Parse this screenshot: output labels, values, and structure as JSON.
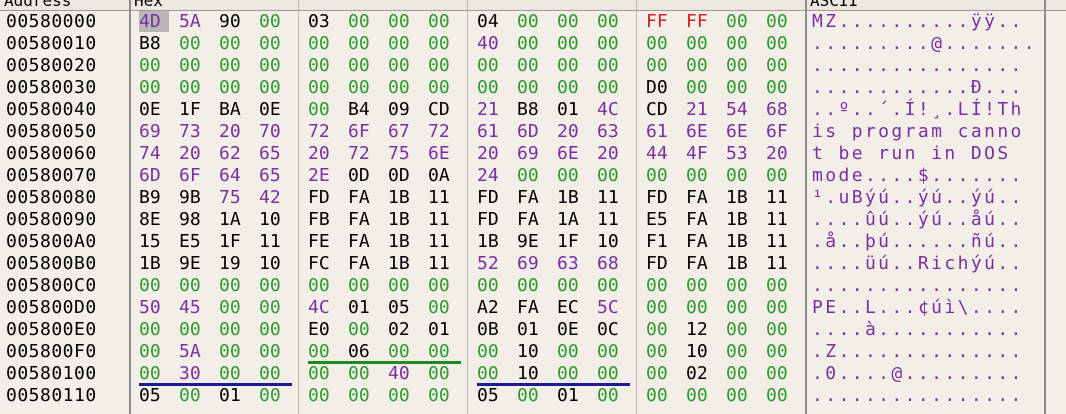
{
  "headers": {
    "address": "Address",
    "hex": "Hex",
    "ascii": "ASCII"
  },
  "colors": {
    "zero": "#2e9a2e",
    "low": "#000000",
    "ascii_byte": "#7a2fa0",
    "ff": "#d42020",
    "underline_blue": "#1a1a9a",
    "underline_green": "#1f8a1f"
  },
  "rows": [
    {
      "address": "00580000",
      "bytes": [
        "4D",
        "5A",
        "90",
        "00",
        "03",
        "00",
        "00",
        "00",
        "04",
        "00",
        "00",
        "00",
        "FF",
        "FF",
        "00",
        "00"
      ],
      "ascii": "MZ..........ÿÿ.."
    },
    {
      "address": "00580010",
      "bytes": [
        "B8",
        "00",
        "00",
        "00",
        "00",
        "00",
        "00",
        "00",
        "40",
        "00",
        "00",
        "00",
        "00",
        "00",
        "00",
        "00"
      ],
      "ascii": ".........@......."
    },
    {
      "address": "00580020",
      "bytes": [
        "00",
        "00",
        "00",
        "00",
        "00",
        "00",
        "00",
        "00",
        "00",
        "00",
        "00",
        "00",
        "00",
        "00",
        "00",
        "00"
      ],
      "ascii": "................"
    },
    {
      "address": "00580030",
      "bytes": [
        "00",
        "00",
        "00",
        "00",
        "00",
        "00",
        "00",
        "00",
        "00",
        "00",
        "00",
        "00",
        "D0",
        "00",
        "00",
        "00"
      ],
      "ascii": "............Ð..."
    },
    {
      "address": "00580040",
      "bytes": [
        "0E",
        "1F",
        "BA",
        "0E",
        "00",
        "B4",
        "09",
        "CD",
        "21",
        "B8",
        "01",
        "4C",
        "CD",
        "21",
        "54",
        "68"
      ],
      "ascii": "..º..´.Í!¸.LÍ!Th"
    },
    {
      "address": "00580050",
      "bytes": [
        "69",
        "73",
        "20",
        "70",
        "72",
        "6F",
        "67",
        "72",
        "61",
        "6D",
        "20",
        "63",
        "61",
        "6E",
        "6E",
        "6F"
      ],
      "ascii": "is program canno"
    },
    {
      "address": "00580060",
      "bytes": [
        "74",
        "20",
        "62",
        "65",
        "20",
        "72",
        "75",
        "6E",
        "20",
        "69",
        "6E",
        "20",
        "44",
        "4F",
        "53",
        "20"
      ],
      "ascii": "t be run in DOS "
    },
    {
      "address": "00580070",
      "bytes": [
        "6D",
        "6F",
        "64",
        "65",
        "2E",
        "0D",
        "0D",
        "0A",
        "24",
        "00",
        "00",
        "00",
        "00",
        "00",
        "00",
        "00"
      ],
      "ascii": "mode....$......."
    },
    {
      "address": "00580080",
      "bytes": [
        "B9",
        "9B",
        "75",
        "42",
        "FD",
        "FA",
        "1B",
        "11",
        "FD",
        "FA",
        "1B",
        "11",
        "FD",
        "FA",
        "1B",
        "11"
      ],
      "ascii": "¹.uBýú..ýú..ýú.."
    },
    {
      "address": "00580090",
      "bytes": [
        "8E",
        "98",
        "1A",
        "10",
        "FB",
        "FA",
        "1B",
        "11",
        "FD",
        "FA",
        "1A",
        "11",
        "E5",
        "FA",
        "1B",
        "11"
      ],
      "ascii": "....ûú..ýú..åú.."
    },
    {
      "address": "005800A0",
      "bytes": [
        "15",
        "E5",
        "1F",
        "11",
        "FE",
        "FA",
        "1B",
        "11",
        "1B",
        "9E",
        "1F",
        "10",
        "F1",
        "FA",
        "1B",
        "11"
      ],
      "ascii": ".å..þú......ñú.."
    },
    {
      "address": "005800B0",
      "bytes": [
        "1B",
        "9E",
        "19",
        "10",
        "FC",
        "FA",
        "1B",
        "11",
        "52",
        "69",
        "63",
        "68",
        "FD",
        "FA",
        "1B",
        "11"
      ],
      "ascii": "....üú..Richýú.."
    },
    {
      "address": "005800C0",
      "bytes": [
        "00",
        "00",
        "00",
        "00",
        "00",
        "00",
        "00",
        "00",
        "00",
        "00",
        "00",
        "00",
        "00",
        "00",
        "00",
        "00"
      ],
      "ascii": "................"
    },
    {
      "address": "005800D0",
      "bytes": [
        "50",
        "45",
        "00",
        "00",
        "4C",
        "01",
        "05",
        "00",
        "A2",
        "FA",
        "EC",
        "5C",
        "00",
        "00",
        "00",
        "00"
      ],
      "ascii": "PE..L...¢úì\\...."
    },
    {
      "address": "005800E0",
      "bytes": [
        "00",
        "00",
        "00",
        "00",
        "E0",
        "00",
        "02",
        "01",
        "0B",
        "01",
        "0E",
        "0C",
        "00",
        "12",
        "00",
        "00"
      ],
      "ascii": "....à..........."
    },
    {
      "address": "005800F0",
      "bytes": [
        "00",
        "5A",
        "00",
        "00",
        "00",
        "06",
        "00",
        "00",
        "00",
        "10",
        "00",
        "00",
        "00",
        "10",
        "00",
        "00"
      ],
      "ascii": ".Z.............."
    },
    {
      "address": "00580100",
      "bytes": [
        "00",
        "30",
        "00",
        "00",
        "00",
        "00",
        "40",
        "00",
        "00",
        "10",
        "00",
        "00",
        "00",
        "02",
        "00",
        "00"
      ],
      "ascii": ".0....@........."
    },
    {
      "address": "00580110",
      "bytes": [
        "05",
        "00",
        "01",
        "00",
        "00",
        "00",
        "00",
        "00",
        "05",
        "00",
        "01",
        "00",
        "00",
        "00",
        "00",
        "00"
      ],
      "ascii": "................"
    }
  ]
}
